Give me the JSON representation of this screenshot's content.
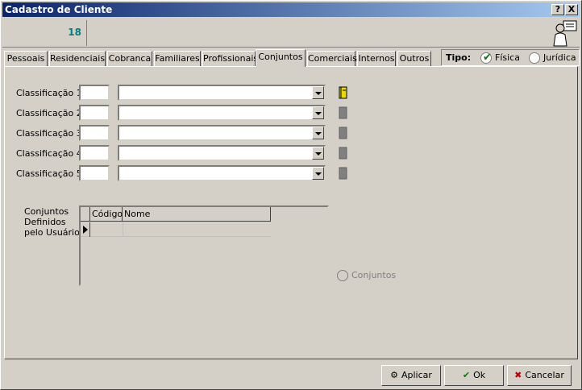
{
  "window": {
    "title": "Cadastro de Cliente",
    "help_label": "?",
    "close_label": "X"
  },
  "header": {
    "code_value": "18"
  },
  "tabs": [
    {
      "label": "Pessoais"
    },
    {
      "label": "Residenciais"
    },
    {
      "label": "Cobranca"
    },
    {
      "label": "Familiares"
    },
    {
      "label": "Profissionais"
    },
    {
      "label": "Conjuntos"
    },
    {
      "label": "Comerciais"
    },
    {
      "label": "Internos"
    },
    {
      "label": "Outros"
    }
  ],
  "active_tab": "Conjuntos",
  "tipo": {
    "label": "Tipo:",
    "options": [
      "Física",
      "Jurídica"
    ],
    "selected": "Física"
  },
  "classifications": [
    {
      "label": "Classificação 1:",
      "code": "",
      "value": ""
    },
    {
      "label": "Classificação 2:",
      "code": "",
      "value": ""
    },
    {
      "label": "Classificação 3:",
      "code": "",
      "value": ""
    },
    {
      "label": "Classificação 4:",
      "code": "",
      "value": ""
    },
    {
      "label": "Classificação 5:",
      "code": "",
      "value": ""
    }
  ],
  "user_sets": {
    "label_lines": [
      "Conjuntos",
      "Definidos",
      "pelo Usuário:"
    ],
    "columns": [
      "Código",
      "Nome"
    ],
    "rows": [],
    "button_label": "Conjuntos"
  },
  "footer": {
    "apply_label": "Aplicar",
    "ok_label": "Ok",
    "cancel_label": "Cancelar"
  },
  "colors": {
    "title_gradient_start": "#0a246a",
    "code_color": "#008080",
    "ok_check": "#008000",
    "cancel_x": "#c00000"
  }
}
